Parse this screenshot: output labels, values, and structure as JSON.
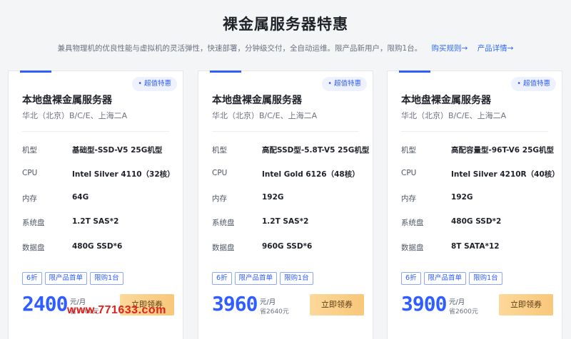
{
  "page": {
    "title": "裸金属服务器特惠",
    "subtitle": "兼具物理机的优良性能与虚拟机的灵活弹性，快速部署，分钟级交付，全自动运维。限产品新用户，限购1台。",
    "link_rules": "购买规则→",
    "link_details": "产品详情→"
  },
  "watermark": "www.771633.com",
  "cards": [
    {
      "badge": "• 超值特惠",
      "name": "本地盘裸金属服务器",
      "region": "华北（北京）B/C/E、上海二A",
      "specs": [
        {
          "k": "机型",
          "v": "基础型-SSD-V5 25G机型"
        },
        {
          "k": "CPU",
          "v": "Intel Silver 4110（32核）"
        },
        {
          "k": "内存",
          "v": "64G"
        },
        {
          "k": "系统盘",
          "v": "1.2T SAS*2"
        },
        {
          "k": "数据盘",
          "v": "480G SSD*6"
        }
      ],
      "tags": [
        "6折",
        "限产品首单",
        "限购1台"
      ],
      "price": "2400",
      "unit": "元/月",
      "save": "省1600元",
      "button": "立即领券"
    },
    {
      "badge": "• 超值特惠",
      "name": "本地盘裸金属服务器",
      "region": "华北（北京）B/C/E、上海二A",
      "specs": [
        {
          "k": "机型",
          "v": "高配SSD型-5.8T-V5 25G机型"
        },
        {
          "k": "CPU",
          "v": "Intel Gold 6126（48核）"
        },
        {
          "k": "内存",
          "v": "192G"
        },
        {
          "k": "系统盘",
          "v": "1.2T SAS*2"
        },
        {
          "k": "数据盘",
          "v": "960G SSD*6"
        }
      ],
      "tags": [
        "6折",
        "限产品首单",
        "限购1台"
      ],
      "price": "3960",
      "unit": "元/月",
      "save": "省2640元",
      "button": "立即领券"
    },
    {
      "badge": "• 超值特惠",
      "name": "本地盘裸金属服务器",
      "region": "华北（北京）B/C/E、上海二A",
      "specs": [
        {
          "k": "机型",
          "v": "高配容量型-96T-V6 25G机型"
        },
        {
          "k": "CPU",
          "v": "Intel Silver 4210R（40核）"
        },
        {
          "k": "内存",
          "v": "192G"
        },
        {
          "k": "系统盘",
          "v": "480G SSD*2"
        },
        {
          "k": "数据盘",
          "v": "8T SATA*12"
        }
      ],
      "tags": [
        "6折",
        "限产品首单",
        "限购1台"
      ],
      "price": "3900",
      "unit": "元/月",
      "save": "省2600元",
      "button": "立即领券"
    }
  ]
}
